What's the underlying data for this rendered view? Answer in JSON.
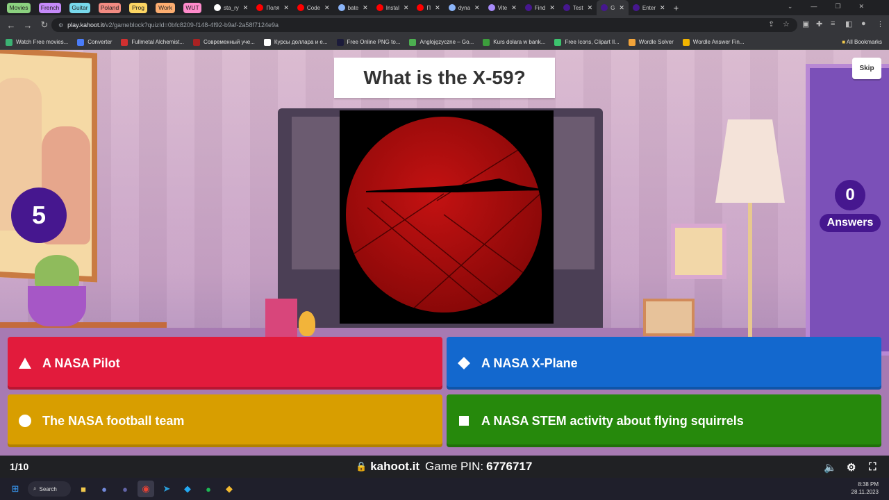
{
  "tab_groups": [
    {
      "label": "Movies",
      "color": "#8bd17f"
    },
    {
      "label": "French",
      "color": "#c58af9"
    },
    {
      "label": "Guitar",
      "color": "#78d9ec"
    },
    {
      "label": "Poland",
      "color": "#f28b82"
    },
    {
      "label": "Prog",
      "color": "#fdd663"
    },
    {
      "label": "Work",
      "color": "#fcad70"
    },
    {
      "label": "WUT",
      "color": "#ff8bcb"
    }
  ],
  "tabs": [
    {
      "title": "sta_ry",
      "icon": "github-icon",
      "color": "#ffffff"
    },
    {
      "title": "Поля",
      "icon": "youtube-icon",
      "color": "#ff0000"
    },
    {
      "title": "Code",
      "icon": "youtube-icon",
      "color": "#ff0000"
    },
    {
      "title": "bate",
      "icon": "google-icon",
      "color": "#8ab4f8"
    },
    {
      "title": "Instal",
      "icon": "youtube-icon",
      "color": "#ff0000"
    },
    {
      "title": "П",
      "icon": "youtube-icon",
      "color": "#ff0000"
    },
    {
      "title": "dyna",
      "icon": "google-icon",
      "color": "#8ab4f8"
    },
    {
      "title": "Vite",
      "icon": "vite-icon",
      "color": "#a78bfa"
    },
    {
      "title": "Find",
      "icon": "kahoot-icon",
      "color": "#46178f"
    },
    {
      "title": "Test",
      "icon": "kahoot-icon",
      "color": "#46178f"
    },
    {
      "title": "G",
      "icon": "kahoot-icon",
      "color": "#46178f",
      "active": true
    },
    {
      "title": "Enter",
      "icon": "kahoot-icon",
      "color": "#46178f"
    }
  ],
  "address": {
    "host": "play.kahoot.it",
    "path": "/v2/gameblock?quizId=0bfc8209-f148-4f92-b9af-2a58f7124e9a"
  },
  "bookmarks": [
    {
      "label": "Watch Free movies...",
      "color": "#3bb273"
    },
    {
      "label": "Converter",
      "color": "#4a7cf7"
    },
    {
      "label": "Fullmetal Alchemist...",
      "color": "#d03030"
    },
    {
      "label": "Современный уче...",
      "color": "#aa2222"
    },
    {
      "label": "Курсы доллара и е...",
      "color": "#ffffff"
    },
    {
      "label": "Free Online PNG to...",
      "color": "#1b1b3a"
    },
    {
      "label": "Anglojęzyczne – Go...",
      "color": "#4caf50"
    },
    {
      "label": "Kurs dolara w bank...",
      "color": "#3c9e3c"
    },
    {
      "label": "Free Icons, Clipart Il...",
      "color": "#3cc46e"
    },
    {
      "label": "Wordle Solver",
      "color": "#f2a43a"
    },
    {
      "label": "Wordle Answer Fin...",
      "color": "#f2b400"
    }
  ],
  "all_bookmarks": "All Bookmarks",
  "question": "What is the X-59?",
  "skip": "Skip",
  "timer": "5",
  "answers_count": "0",
  "answers_label": "Answers",
  "answers": [
    {
      "text": "A NASA Pilot",
      "shape": "triangle"
    },
    {
      "text": "A NASA X-Plane",
      "shape": "diamond"
    },
    {
      "text": "The NASA football team",
      "shape": "circle"
    },
    {
      "text": "A NASA STEM activity about flying squirrels",
      "shape": "square"
    }
  ],
  "progress": "1/10",
  "pin_site": "kahoot.it",
  "pin_label": "Game PIN:",
  "pin": "6776717",
  "taskbar_search": "Search",
  "clock": {
    "time": "8:38 PM",
    "date": "28.11.2023"
  },
  "colors": {
    "red": "#e21b3c",
    "blue": "#1368ce",
    "yellow": "#d89e00",
    "green": "#26890c",
    "purple": "#46178f"
  }
}
